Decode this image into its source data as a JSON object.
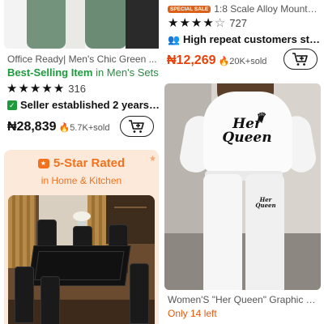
{
  "products": [
    {
      "title": "Office Ready| Men's Chic Green ...",
      "best_label": "Best-Selling Item",
      "best_context": " in Men's Sets",
      "rating": {
        "stars": 4.5,
        "count": "316"
      },
      "seller_note": "Seller established 2 years ...",
      "price": "₦28,839",
      "sold": "5.7K+sold"
    },
    {
      "badge": "SPECIAL SALE",
      "title": "1:8 Scale Alloy Mountain B...",
      "rating": {
        "stars": 4.5,
        "count": "727"
      },
      "repeat_note": "High repeat customers sto...",
      "price": "₦12,269",
      "sold": "20K+sold"
    },
    {
      "promo_heading": "5-Star Rated",
      "promo_sub": "in Home & Kitchen"
    },
    {
      "logo_text_1": "Her",
      "logo_text_2": "Queen",
      "title": "Women'S \"Her Queen\" Graphic H...",
      "stock": "Only 14 left"
    }
  ],
  "colors": {
    "price_sale": "#e8420a",
    "green_accent": "#1d9b3c",
    "orange_accent": "#f2711c"
  },
  "icons": [
    "add-to-cart-icon",
    "flame-icon",
    "bag-check-icon",
    "people-icon",
    "rated-chat-icon"
  ]
}
